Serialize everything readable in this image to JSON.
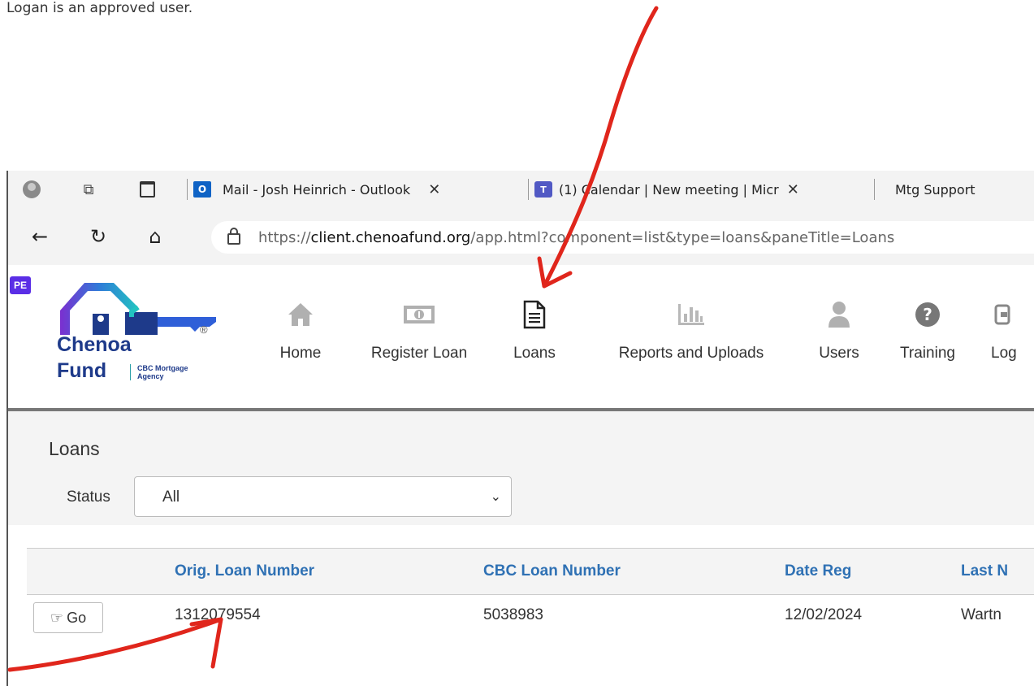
{
  "caption": "Logan is an approved user.",
  "browser": {
    "tabs": [
      {
        "label": "Mail - Josh Heinrich - Outlook",
        "icon": "outlook-icon",
        "close": "✕"
      },
      {
        "label": "(1) Calendar | New meeting | Micr",
        "icon": "teams-icon",
        "close": "✕"
      },
      {
        "label": "Mtg Support",
        "icon": ""
      }
    ],
    "url_scheme": "https://",
    "url_domain": "client.chenoafund.org",
    "url_path": "/app.html?component=list&type=loans&paneTitle=Loans"
  },
  "site": {
    "badge": "PE",
    "brand_line1": "Chenoa",
    "brand_line2": "Fund",
    "brand_sub1": "CBC Mortgage",
    "brand_sub2": "Agency",
    "registered": "®",
    "nav": [
      {
        "label": "Home",
        "icon": "home-icon"
      },
      {
        "label": "Register Loan",
        "icon": "money-icon"
      },
      {
        "label": "Loans",
        "icon": "document-icon"
      },
      {
        "label": "Reports and Uploads",
        "icon": "bar-chart-icon"
      },
      {
        "label": "Users",
        "icon": "user-icon"
      },
      {
        "label": "Training",
        "icon": "help-icon"
      },
      {
        "label": "Log",
        "icon": "logout-icon"
      }
    ]
  },
  "loans_page": {
    "title": "Loans",
    "status_label": "Status",
    "status_value": "All",
    "columns": [
      "Orig. Loan Number",
      "CBC Loan Number",
      "Date Reg",
      "Last N"
    ],
    "rows": [
      {
        "go": "Go",
        "orig": "1312079554",
        "cbc": "5038983",
        "date": "12/02/2024",
        "last": "Wartn"
      }
    ]
  },
  "colors": {
    "accent_blue": "#2f71b4",
    "brand_navy": "#1e3a8a",
    "annotation_red": "#e0261c"
  }
}
